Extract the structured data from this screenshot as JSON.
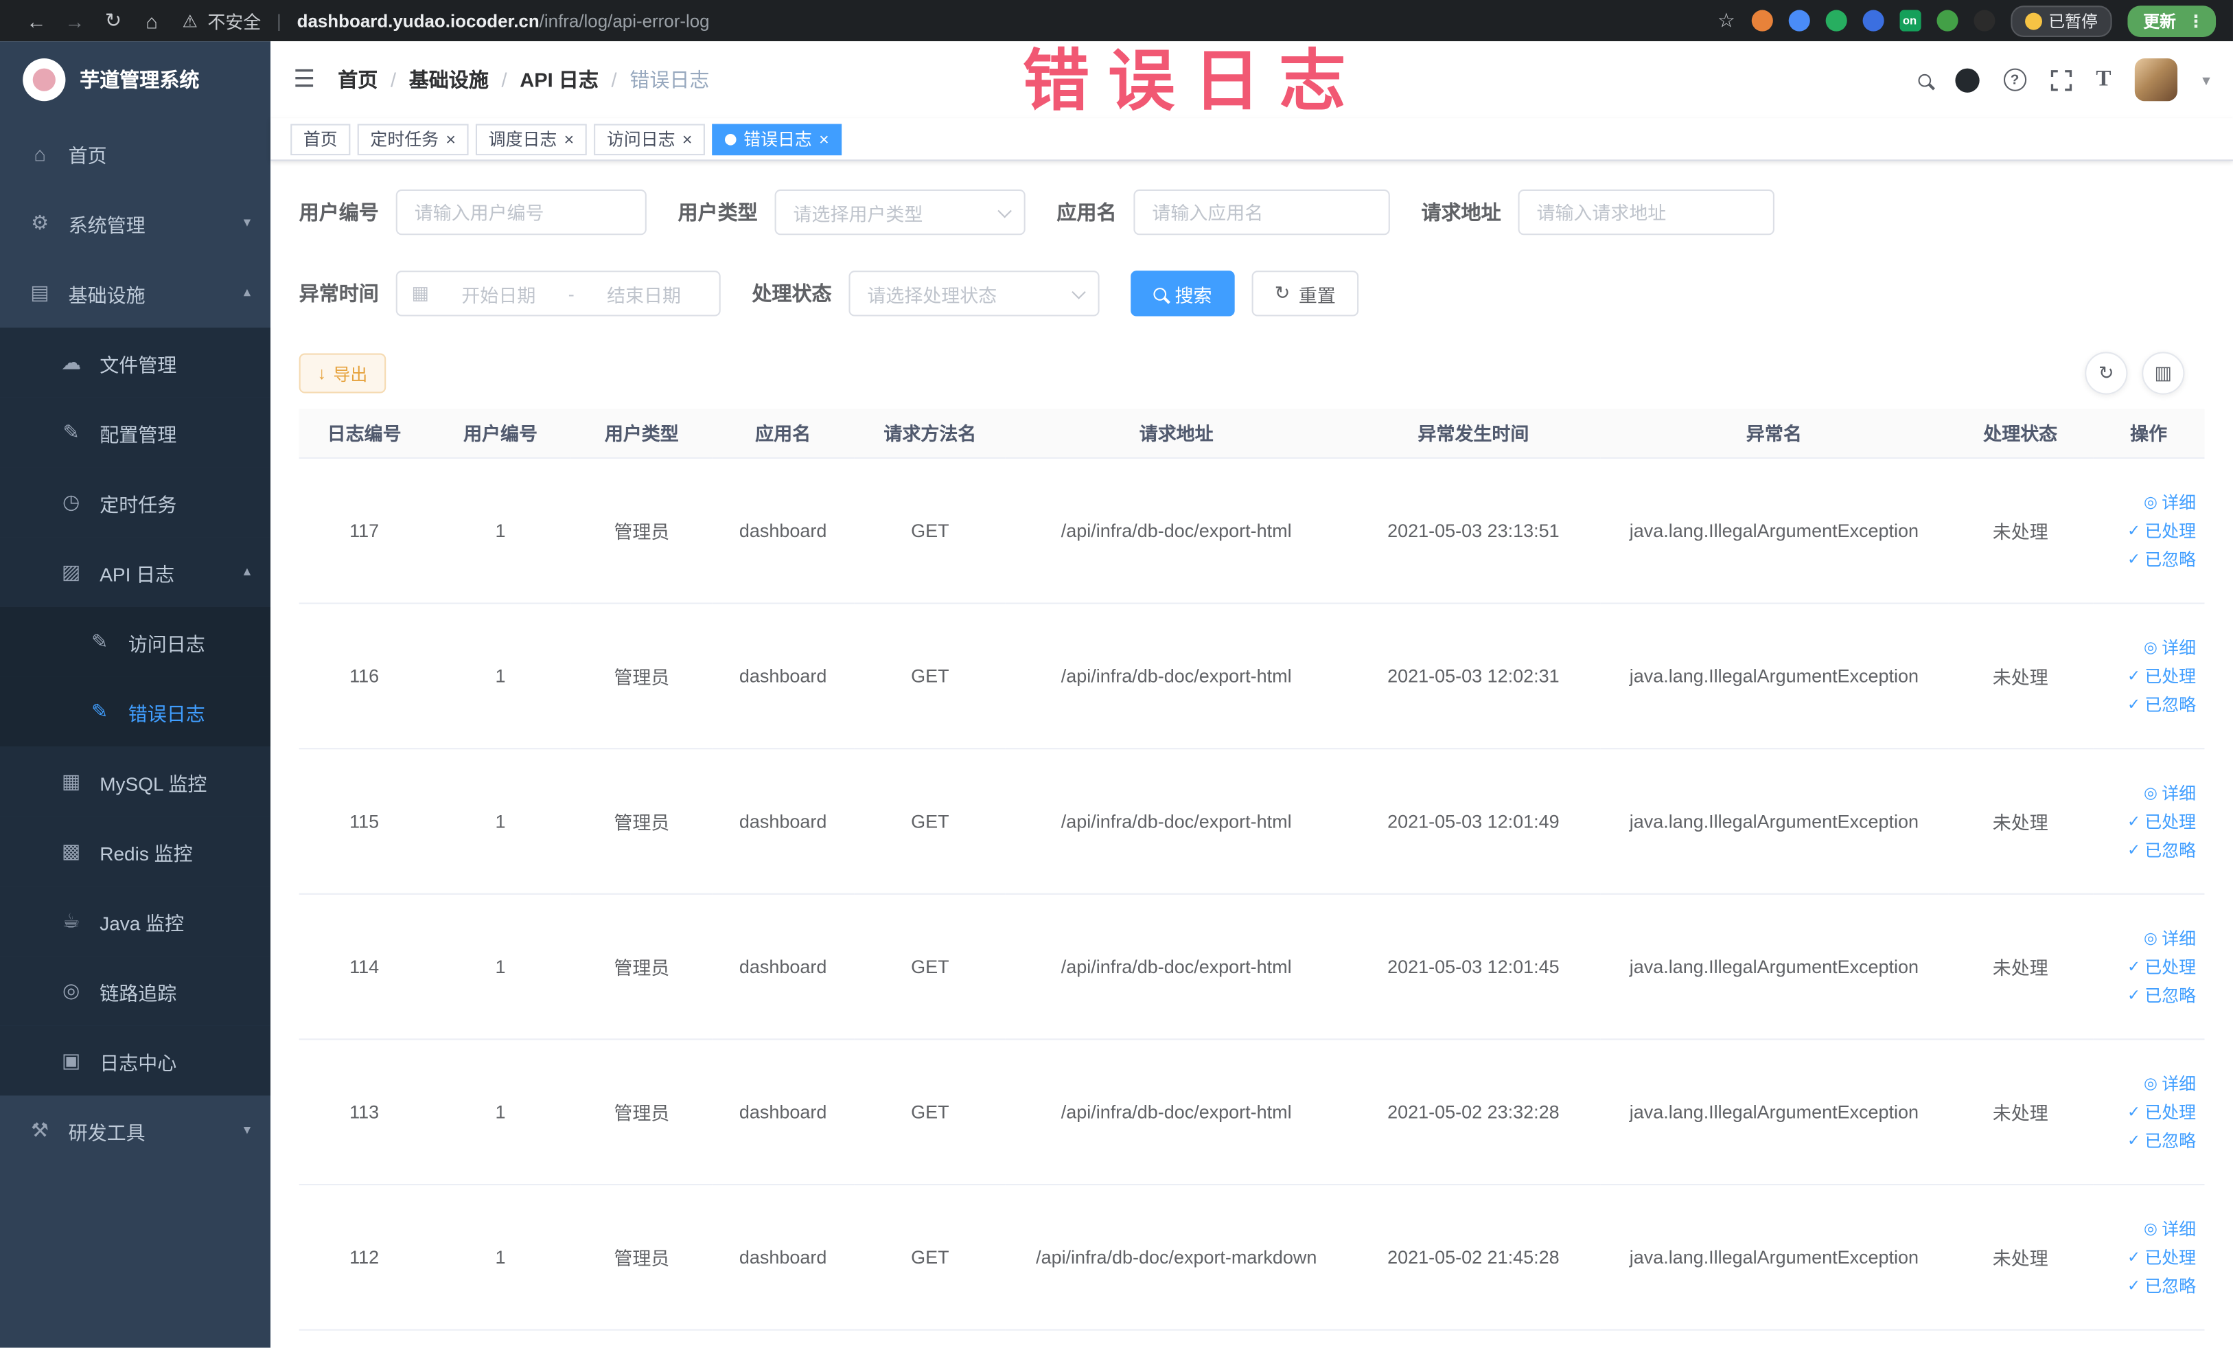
{
  "annotation": {
    "text": "错误日志"
  },
  "colors": {
    "primary": "#409eff",
    "sidebar_bg": "#304156",
    "submenu_bg": "#1f2d3d",
    "warning": "#e6a23c",
    "annotation_red": "#f1506c",
    "active_tab_bg": "#409eff",
    "update_green": "#58a55c"
  },
  "browser": {
    "nav_icons": [
      "back-icon",
      "forward-icon",
      "reload-icon",
      "home-icon"
    ],
    "security_label": "不安全",
    "url_domain": "dashboard.yudao.iocoder.cn",
    "url_path": "/infra/log/api-error-log",
    "paused_badge": "已暂停",
    "update_button": "更新"
  },
  "sidebar": {
    "logo_title": "芋道管理系统",
    "items": [
      {
        "name": "home",
        "label": "首页",
        "icon": "home-icon",
        "depth": 0
      },
      {
        "name": "system-manage",
        "label": "系统管理",
        "icon": "gear-icon",
        "depth": 0,
        "arrow": "down"
      },
      {
        "name": "infrastructure",
        "label": "基础设施",
        "icon": "infrastructure-icon",
        "depth": 0,
        "arrow": "up"
      },
      {
        "name": "file-manage",
        "label": "文件管理",
        "icon": "file-manage-icon",
        "depth": 1
      },
      {
        "name": "config-manage",
        "label": "配置管理",
        "icon": "config-manage-icon",
        "depth": 1
      },
      {
        "name": "scheduled-task",
        "label": "定时任务",
        "icon": "scheduled-task-icon",
        "depth": 1
      },
      {
        "name": "api-log",
        "label": "API 日志",
        "icon": "api-log-icon",
        "depth": 1,
        "arrow": "up"
      },
      {
        "name": "access-log",
        "label": "访问日志",
        "icon": "access-log-icon",
        "depth": 2
      },
      {
        "name": "error-log",
        "label": "错误日志",
        "icon": "error-log-icon",
        "depth": 2,
        "active": true
      },
      {
        "name": "mysql-monitor",
        "label": "MySQL 监控",
        "icon": "mysql-monitor-icon",
        "depth": 1
      },
      {
        "name": "redis-monitor",
        "label": "Redis 监控",
        "icon": "redis-monitor-icon",
        "depth": 1
      },
      {
        "name": "java-monitor",
        "label": "Java 监控",
        "icon": "java-monitor-icon",
        "depth": 1
      },
      {
        "name": "trace",
        "label": "链路追踪",
        "icon": "trace-icon",
        "depth": 1
      },
      {
        "name": "log-center",
        "label": "日志中心",
        "icon": "log-center-icon",
        "depth": 1
      },
      {
        "name": "devtools",
        "label": "研发工具",
        "icon": "devtools-icon",
        "depth": 0,
        "arrow": "down"
      }
    ]
  },
  "navbar": {
    "breadcrumb": [
      "首页",
      "基础设施",
      "API 日志",
      "错误日志"
    ],
    "icons": [
      "search-icon",
      "github-icon",
      "help-icon",
      "fullscreen-icon",
      "font-size-icon",
      "avatar",
      "chevron-down-icon"
    ]
  },
  "tabs": [
    {
      "name": "home",
      "label": "首页",
      "closable": false,
      "active": false
    },
    {
      "name": "scheduled-task",
      "label": "定时任务",
      "closable": true,
      "active": false
    },
    {
      "name": "schedule-log",
      "label": "调度日志",
      "closable": true,
      "active": false
    },
    {
      "name": "access-log",
      "label": "访问日志",
      "closable": true,
      "active": false
    },
    {
      "name": "error-log",
      "label": "错误日志",
      "closable": true,
      "active": true
    }
  ],
  "filters": {
    "user_id": {
      "label": "用户编号",
      "placeholder": "请输入用户编号"
    },
    "user_type": {
      "label": "用户类型",
      "placeholder": "请选择用户类型"
    },
    "app_name": {
      "label": "应用名",
      "placeholder": "请输入应用名"
    },
    "request_url": {
      "label": "请求地址",
      "placeholder": "请输入请求地址"
    },
    "exception_time": {
      "label": "异常时间",
      "start_placeholder": "开始日期",
      "separator": "-",
      "end_placeholder": "结束日期"
    },
    "process_status": {
      "label": "处理状态",
      "placeholder": "请选择处理状态"
    },
    "search_button": "搜索",
    "reset_button": "重置"
  },
  "toolbar": {
    "export_button": "导出"
  },
  "table": {
    "columns": [
      "日志编号",
      "用户编号",
      "用户类型",
      "应用名",
      "请求方法名",
      "请求地址",
      "异常发生时间",
      "异常名",
      "处理状态",
      "操作"
    ],
    "row_actions": [
      "详细",
      "已处理",
      "已忽略"
    ],
    "rows": [
      {
        "log_id": "117",
        "user_id": "1",
        "user_type": "管理员",
        "app_name": "dashboard",
        "method": "GET",
        "url": "/api/infra/db-doc/export-html",
        "time": "2021-05-03 23:13:51",
        "exception": "java.lang.IllegalArgumentException",
        "status": "未处理"
      },
      {
        "log_id": "116",
        "user_id": "1",
        "user_type": "管理员",
        "app_name": "dashboard",
        "method": "GET",
        "url": "/api/infra/db-doc/export-html",
        "time": "2021-05-03 12:02:31",
        "exception": "java.lang.IllegalArgumentException",
        "status": "未处理"
      },
      {
        "log_id": "115",
        "user_id": "1",
        "user_type": "管理员",
        "app_name": "dashboard",
        "method": "GET",
        "url": "/api/infra/db-doc/export-html",
        "time": "2021-05-03 12:01:49",
        "exception": "java.lang.IllegalArgumentException",
        "status": "未处理"
      },
      {
        "log_id": "114",
        "user_id": "1",
        "user_type": "管理员",
        "app_name": "dashboard",
        "method": "GET",
        "url": "/api/infra/db-doc/export-html",
        "time": "2021-05-03 12:01:45",
        "exception": "java.lang.IllegalArgumentException",
        "status": "未处理"
      },
      {
        "log_id": "113",
        "user_id": "1",
        "user_type": "管理员",
        "app_name": "dashboard",
        "method": "GET",
        "url": "/api/infra/db-doc/export-html",
        "time": "2021-05-02 23:32:28",
        "exception": "java.lang.IllegalArgumentException",
        "status": "未处理"
      },
      {
        "log_id": "112",
        "user_id": "1",
        "user_type": "管理员",
        "app_name": "dashboard",
        "method": "GET",
        "url": "/api/infra/db-doc/export-markdown",
        "time": "2021-05-02 21:45:28",
        "exception": "java.lang.IllegalArgumentException",
        "status": "未处理"
      }
    ]
  }
}
